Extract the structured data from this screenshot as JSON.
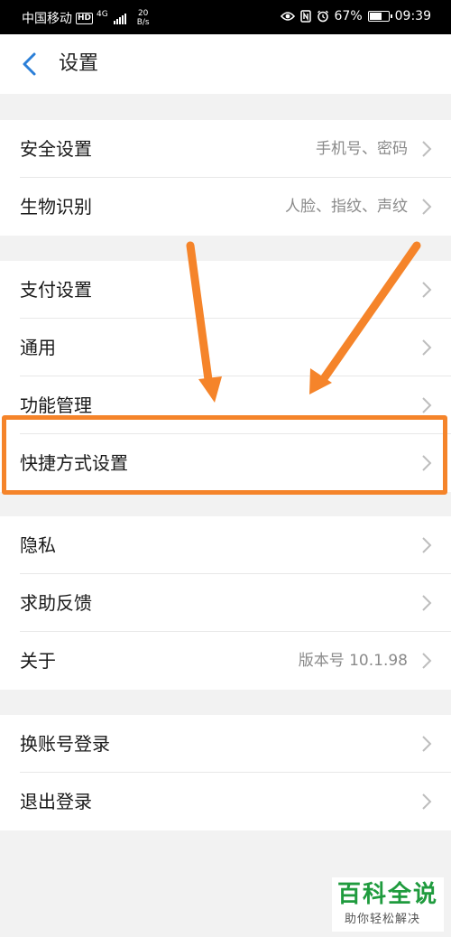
{
  "status_bar": {
    "carrier": "中国移动",
    "hd": "HD",
    "network": "4G",
    "speed_value": "20",
    "speed_unit": "B/s",
    "battery": "67%",
    "battery_level": 0.67,
    "time": "09:39"
  },
  "header": {
    "title": "设置"
  },
  "groups": [
    {
      "rows": [
        {
          "label": "安全设置",
          "value": "手机号、密码"
        },
        {
          "label": "生物识别",
          "value": "人脸、指纹、声纹"
        }
      ]
    },
    {
      "rows": [
        {
          "label": "支付设置",
          "value": ""
        },
        {
          "label": "通用",
          "value": ""
        },
        {
          "label": "功能管理",
          "value": ""
        },
        {
          "label": "快捷方式设置",
          "value": ""
        }
      ]
    },
    {
      "rows": [
        {
          "label": "隐私",
          "value": ""
        },
        {
          "label": "求助反馈",
          "value": ""
        },
        {
          "label": "关于",
          "value": "版本号 10.1.98"
        }
      ]
    },
    {
      "rows": [
        {
          "label": "换账号登录",
          "value": ""
        },
        {
          "label": "退出登录",
          "value": ""
        }
      ]
    }
  ],
  "annotation_color": "#f5842a",
  "watermark": {
    "main": "百科全说",
    "sub": "助你轻松解决"
  }
}
